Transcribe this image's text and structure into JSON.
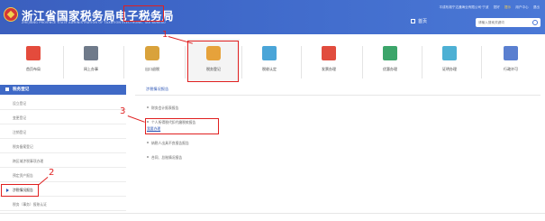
{
  "header": {
    "title": "浙江省国家税务局电子税务局",
    "subtitle": "ZHEJIANG PROVINCE STATE ADMINISTRATION OF TAXATION ELECTRONIC TAX BUREAU",
    "top_info": "平成布湘宁达通海业有限公司·宁波",
    "user_label": "您好",
    "warn": "提示",
    "user_center": "用户中心",
    "exit": "退出",
    "home_label": "首页",
    "search_placeholder": "请输入搜索关键词"
  },
  "nav": {
    "items": [
      {
        "label": "首页布局",
        "color": "#e44b3c"
      },
      {
        "label": "网上办事",
        "color": "#6f7a8a"
      },
      {
        "label": "出口退税",
        "color": "#d9a23b"
      },
      {
        "label": "税务登记",
        "color": "#e6a23b"
      },
      {
        "label": "税收认定",
        "color": "#4aa5d8"
      },
      {
        "label": "发票办理",
        "color": "#e14c3e"
      },
      {
        "label": "优惠办理",
        "color": "#3ca56a"
      },
      {
        "label": "证明办理",
        "color": "#4db0d4"
      },
      {
        "label": "行政许可",
        "color": "#5a7fd0"
      }
    ]
  },
  "annotations": {
    "a1": "1",
    "a2": "2",
    "a3": "3"
  },
  "sidebar": {
    "header": "税务登记",
    "items": [
      {
        "label": "设立登记"
      },
      {
        "label": "变更登记"
      },
      {
        "label": "注销登记"
      },
      {
        "label": "税务备案登记"
      },
      {
        "label": "跨区域涉税事项办理"
      },
      {
        "label": "预定资产报告"
      },
      {
        "label": "涉税情况报告"
      },
      {
        "label": "税务（事务）报账认证"
      }
    ]
  },
  "main": {
    "tab": "涉税情况报告",
    "items": [
      {
        "label": "财务会计报表报告"
      },
      {
        "label": "个人所得税代扣代缴税款报告"
      },
      {
        "label": "纳税人出具不良报告报告"
      },
      {
        "label": "合同、总账情况报告"
      }
    ],
    "button": "我要办理"
  }
}
